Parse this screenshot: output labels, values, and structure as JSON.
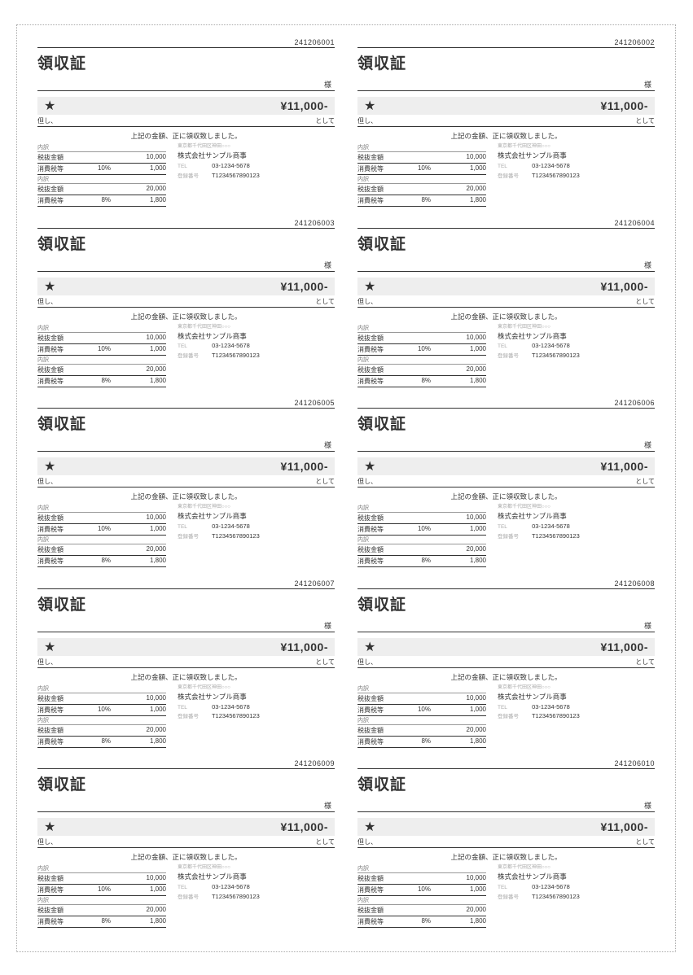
{
  "template": {
    "title": "領収証",
    "payee_suffix": "様",
    "amount": "¥11,000-",
    "proviso_left": "但し、",
    "proviso_right": "として",
    "confirm": "上記の金額、正に領収致しました。",
    "breakdown_header": "内訳",
    "rows": [
      {
        "label": "税抜金額",
        "rate": "",
        "value": "10,000"
      },
      {
        "label": "消費税等",
        "rate": "10%",
        "value": "1,000"
      }
    ],
    "breakdown_header2": "内訳",
    "rows2": [
      {
        "label": "税抜金額",
        "rate": "",
        "value": "20,000"
      },
      {
        "label": "消費税等",
        "rate": "8%",
        "value": "1,800"
      }
    ],
    "issuer": {
      "address": "東京都千代田区神田○○○",
      "company": "株式会社サンプル商事",
      "tel_label": "TEL",
      "tel": "03-1234-5678",
      "reg_label": "登録番号",
      "reg": "T1234567890123"
    }
  },
  "receipts": [
    {
      "serial": "241206001"
    },
    {
      "serial": "241206002"
    },
    {
      "serial": "241206003"
    },
    {
      "serial": "241206004"
    },
    {
      "serial": "241206005"
    },
    {
      "serial": "241206006"
    },
    {
      "serial": "241206007"
    },
    {
      "serial": "241206008"
    },
    {
      "serial": "241206009"
    },
    {
      "serial": "241206010"
    }
  ]
}
